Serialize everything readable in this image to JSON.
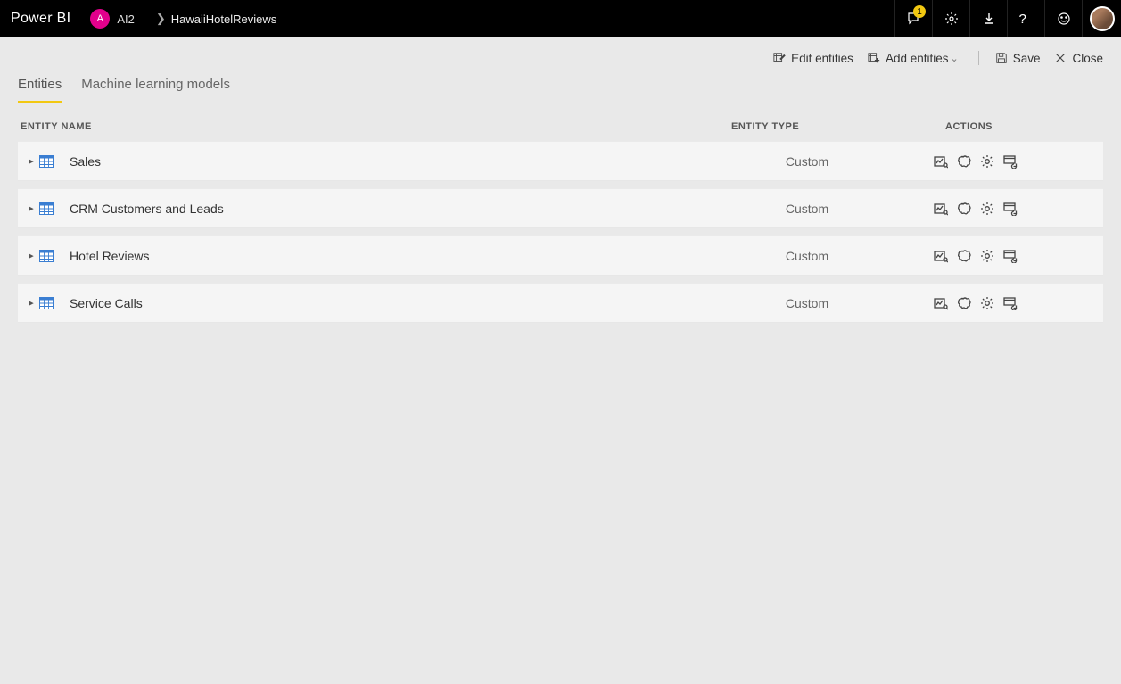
{
  "header": {
    "brand": "Power BI",
    "workspace_initial": "A",
    "workspace_name": "AI2",
    "breadcrumb_item": "HawaiiHotelReviews",
    "notification_count": "1"
  },
  "toolbar": {
    "edit_entities": "Edit entities",
    "add_entities": "Add entities",
    "save": "Save",
    "close": "Close"
  },
  "tabs": {
    "entities": "Entities",
    "ml_models": "Machine learning models"
  },
  "columns": {
    "name": "ENTITY NAME",
    "type": "ENTITY TYPE",
    "actions": "ACTIONS"
  },
  "entities": [
    {
      "name": "Sales",
      "type": "Custom"
    },
    {
      "name": "CRM Customers and Leads",
      "type": "Custom"
    },
    {
      "name": "Hotel Reviews",
      "type": "Custom"
    },
    {
      "name": "Service Calls",
      "type": "Custom"
    }
  ]
}
